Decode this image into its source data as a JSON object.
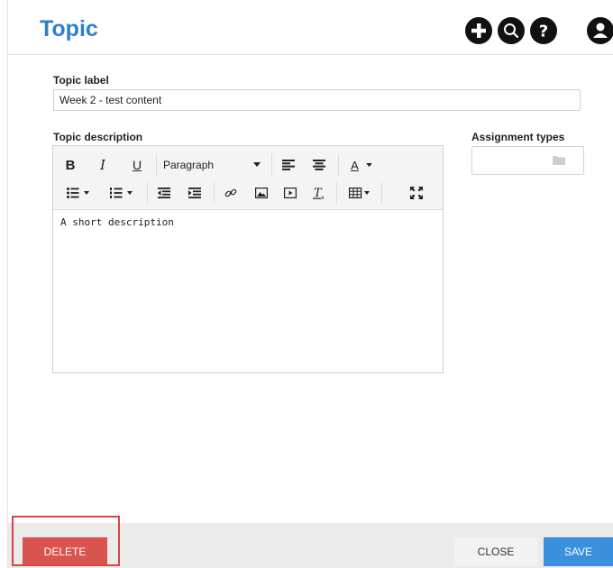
{
  "header": {
    "title": "Topic",
    "actions": [
      {
        "icon": "plus-icon"
      },
      {
        "icon": "search-icon"
      },
      {
        "icon": "help-icon"
      },
      {
        "icon": "user-icon"
      }
    ]
  },
  "form": {
    "topic_label": {
      "label": "Topic label",
      "value": "Week 2 - test content"
    },
    "topic_description": {
      "label": "Topic description",
      "content": "A short description",
      "toolbar": {
        "bold": "B",
        "italic": "I",
        "underline": "U",
        "format_select": "Paragraph",
        "text_color": "A"
      }
    },
    "assignment_types": {
      "label": "Assignment types"
    }
  },
  "footer": {
    "delete_label": "DELETE",
    "close_label": "CLOSE",
    "save_label": "SAVE"
  },
  "colors": {
    "title": "#2e7fd1",
    "delete": "#d9534f",
    "save": "#3a90dd",
    "highlight": "#d64541"
  }
}
